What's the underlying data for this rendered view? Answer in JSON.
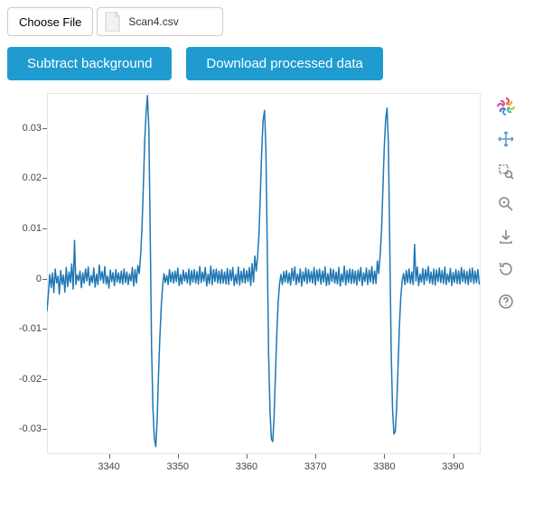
{
  "filepicker": {
    "button_label": "Choose File",
    "filename": "Scan4.csv"
  },
  "buttons": {
    "subtract": "Subtract background",
    "download": "Download processed data"
  },
  "toolbar": {
    "logo": "bokeh-logo",
    "tools": [
      {
        "name": "pan-icon",
        "active": true
      },
      {
        "name": "box-zoom-icon",
        "active": false
      },
      {
        "name": "wheel-zoom-icon",
        "active": false
      },
      {
        "name": "save-icon",
        "active": false
      },
      {
        "name": "reset-icon",
        "active": false
      },
      {
        "name": "help-icon",
        "active": false
      }
    ]
  },
  "chart_data": {
    "type": "line",
    "title": "",
    "xlabel": "",
    "ylabel": "",
    "xlim": [
      3331,
      3394
    ],
    "ylim": [
      -0.035,
      0.037
    ],
    "x_ticks": [
      3340,
      3350,
      3360,
      3370,
      3380,
      3390
    ],
    "y_ticks": [
      -0.03,
      -0.02,
      -0.01,
      0,
      0.01,
      0.02,
      0.03
    ],
    "series_color": "#1f77b4",
    "x": [
      3331.0,
      3331.2,
      3331.4,
      3331.6,
      3331.8,
      3332.0,
      3332.2,
      3332.4,
      3332.6,
      3332.8,
      3333.0,
      3333.2,
      3333.4,
      3333.6,
      3333.8,
      3334.0,
      3334.2,
      3334.4,
      3334.6,
      3334.8,
      3335.0,
      3335.2,
      3335.4,
      3335.6,
      3335.8,
      3336.0,
      3336.2,
      3336.4,
      3336.6,
      3336.8,
      3337.0,
      3337.2,
      3337.4,
      3337.6,
      3337.8,
      3338.0,
      3338.2,
      3338.4,
      3338.6,
      3338.8,
      3339.0,
      3339.2,
      3339.4,
      3339.6,
      3339.8,
      3340.0,
      3340.2,
      3340.4,
      3340.6,
      3340.8,
      3341.0,
      3341.2,
      3341.4,
      3341.6,
      3341.8,
      3342.0,
      3342.2,
      3342.4,
      3342.6,
      3342.8,
      3343.0,
      3343.2,
      3343.4,
      3343.6,
      3343.8,
      3344.0,
      3344.2,
      3344.4,
      3344.6,
      3344.8,
      3345.0,
      3345.2,
      3345.4,
      3345.6,
      3345.8,
      3346.0,
      3346.2,
      3346.4,
      3346.6,
      3346.8,
      3347.0,
      3347.2,
      3347.4,
      3347.6,
      3347.8,
      3348.0,
      3348.2,
      3348.4,
      3348.6,
      3348.8,
      3349.0,
      3349.2,
      3349.4,
      3349.6,
      3349.8,
      3350.0,
      3350.2,
      3350.4,
      3350.6,
      3350.8,
      3351.0,
      3351.2,
      3351.4,
      3351.6,
      3351.8,
      3352.0,
      3352.2,
      3352.4,
      3352.6,
      3352.8,
      3353.0,
      3353.2,
      3353.4,
      3353.6,
      3353.8,
      3354.0,
      3354.2,
      3354.4,
      3354.6,
      3354.8,
      3355.0,
      3355.2,
      3355.4,
      3355.6,
      3355.8,
      3356.0,
      3356.2,
      3356.4,
      3356.6,
      3356.8,
      3357.0,
      3357.2,
      3357.4,
      3357.6,
      3357.8,
      3358.0,
      3358.2,
      3358.4,
      3358.6,
      3358.8,
      3359.0,
      3359.2,
      3359.4,
      3359.6,
      3359.8,
      3360.0,
      3360.2,
      3360.4,
      3360.6,
      3360.8,
      3361.0,
      3361.2,
      3361.4,
      3361.6,
      3361.8,
      3362.0,
      3362.2,
      3362.4,
      3362.6,
      3362.8,
      3363.0,
      3363.2,
      3363.4,
      3363.6,
      3363.8,
      3364.0,
      3364.2,
      3364.4,
      3364.6,
      3364.8,
      3365.0,
      3365.2,
      3365.4,
      3365.6,
      3365.8,
      3366.0,
      3366.2,
      3366.4,
      3366.6,
      3366.8,
      3367.0,
      3367.2,
      3367.4,
      3367.6,
      3367.8,
      3368.0,
      3368.2,
      3368.4,
      3368.6,
      3368.8,
      3369.0,
      3369.2,
      3369.4,
      3369.6,
      3369.8,
      3370.0,
      3370.2,
      3370.4,
      3370.6,
      3370.8,
      3371.0,
      3371.2,
      3371.4,
      3371.6,
      3371.8,
      3372.0,
      3372.2,
      3372.4,
      3372.6,
      3372.8,
      3373.0,
      3373.2,
      3373.4,
      3373.6,
      3373.8,
      3374.0,
      3374.2,
      3374.4,
      3374.6,
      3374.8,
      3375.0,
      3375.2,
      3375.4,
      3375.6,
      3375.8,
      3376.0,
      3376.2,
      3376.4,
      3376.6,
      3376.8,
      3377.0,
      3377.2,
      3377.4,
      3377.6,
      3377.8,
      3378.0,
      3378.2,
      3378.4,
      3378.6,
      3378.8,
      3379.0,
      3379.2,
      3379.4,
      3379.6,
      3379.8,
      3380.0,
      3380.2,
      3380.4,
      3380.6,
      3380.8,
      3381.0,
      3381.2,
      3381.4,
      3381.6,
      3381.8,
      3382.0,
      3382.2,
      3382.4,
      3382.6,
      3382.8,
      3383.0,
      3383.2,
      3383.4,
      3383.6,
      3383.8,
      3384.0,
      3384.2,
      3384.4,
      3384.6,
      3384.8,
      3385.0,
      3385.2,
      3385.4,
      3385.6,
      3385.8,
      3386.0,
      3386.2,
      3386.4,
      3386.6,
      3386.8,
      3387.0,
      3387.2,
      3387.4,
      3387.6,
      3387.8,
      3388.0,
      3388.2,
      3388.4,
      3388.6,
      3388.8,
      3389.0,
      3389.2,
      3389.4,
      3389.6,
      3389.8,
      3390.0,
      3390.2,
      3390.4,
      3390.6,
      3390.8,
      3391.0,
      3391.2,
      3391.4,
      3391.6,
      3391.8,
      3392.0,
      3392.2,
      3392.4,
      3392.6,
      3392.8,
      3393.0,
      3393.2,
      3393.4,
      3393.6,
      3393.8,
      3394.0
    ],
    "y": [
      -0.0065,
      -0.0032,
      0.0008,
      -0.0018,
      0.0011,
      -0.0028,
      0.0019,
      -0.0009,
      0.0005,
      -0.0031,
      0.0016,
      -0.0012,
      0.0007,
      -0.0027,
      0.0022,
      -0.0016,
      0.0013,
      -0.0008,
      0.0029,
      -0.0021,
      0.0076,
      -0.0012,
      0.0007,
      -0.0004,
      0.0015,
      -0.0018,
      0.0011,
      -0.0009,
      0.0019,
      -0.0005,
      0.0023,
      -0.0014,
      0.0006,
      -0.0008,
      0.0021,
      -0.0017,
      0.0009,
      -0.0012,
      0.0027,
      -0.0003,
      0.0014,
      -0.0009,
      0.0024,
      -0.0011,
      0.0005,
      -0.0019,
      0.0017,
      -0.0006,
      0.0012,
      -0.0014,
      0.0018,
      -0.0007,
      0.0011,
      -0.0009,
      0.0015,
      -0.0011,
      0.0019,
      -0.0008,
      0.0013,
      -0.0012,
      0.0009,
      -0.0005,
      0.0022,
      -0.0015,
      0.0018,
      -0.0009,
      0.0026,
      0.001,
      0.0045,
      0.0098,
      0.0185,
      0.0275,
      0.033,
      0.0365,
      0.0295,
      0.0085,
      -0.014,
      -0.026,
      -0.032,
      -0.0335,
      -0.0285,
      -0.0195,
      -0.0115,
      -0.0055,
      -0.0015,
      0.001,
      -0.0008,
      0.0006,
      -0.0012,
      0.0018,
      -0.0007,
      0.0013,
      -0.0009,
      0.0015,
      -0.0006,
      0.0021,
      -0.0014,
      0.0008,
      -0.0011,
      0.0017,
      -0.0005,
      0.0012,
      -0.0009,
      0.0019,
      -0.0013,
      0.0016,
      -0.0007,
      0.0018,
      -0.0009,
      0.0014,
      -0.0011,
      0.0024,
      -0.0008,
      0.0013,
      -0.0005,
      0.0022,
      -0.0015,
      0.0009,
      -0.001,
      0.0025,
      -0.0012,
      0.0018,
      -0.0006,
      0.0019,
      -0.0009,
      0.0015,
      -0.001,
      0.0018,
      -0.0009,
      0.0013,
      -0.0011,
      0.002,
      -0.0012,
      0.0017,
      -0.0004,
      0.0022,
      -0.0014,
      0.0008,
      -0.001,
      0.0023,
      -0.0013,
      0.0015,
      -0.0008,
      0.002,
      -0.0009,
      0.0016,
      -0.0006,
      0.0022,
      -0.0014,
      0.003,
      -0.0007,
      0.0045,
      0.0015,
      0.0042,
      0.009,
      0.017,
      0.0255,
      0.0315,
      0.0335,
      0.026,
      0.0065,
      -0.015,
      -0.0265,
      -0.032,
      -0.0325,
      -0.0275,
      -0.0185,
      -0.0105,
      -0.0045,
      -0.001,
      0.0008,
      -0.0012,
      0.0014,
      -0.0007,
      0.0016,
      -0.0009,
      0.0011,
      -0.0013,
      0.002,
      -0.0004,
      0.0023,
      -0.0012,
      0.0009,
      -0.0008,
      0.0019,
      -0.0015,
      0.0013,
      -0.0006,
      0.0021,
      -0.001,
      0.0018,
      -0.0007,
      0.0014,
      -0.0009,
      0.0022,
      -0.0013,
      0.0017,
      -0.0005,
      0.0019,
      -0.0011,
      0.0015,
      -0.0007,
      0.0023,
      -0.0014,
      0.001,
      -0.0012,
      0.002,
      -0.0006,
      0.0018,
      -0.0009,
      0.0013,
      -0.0011,
      0.0022,
      -0.0015,
      0.0009,
      -0.0007,
      0.0025,
      -0.0013,
      0.0016,
      -0.0008,
      0.0019,
      -0.001,
      0.0018,
      -0.0009,
      0.0015,
      -0.0013,
      0.0017,
      -0.0005,
      0.0022,
      -0.0014,
      0.0011,
      -0.0006,
      0.0021,
      -0.0012,
      0.0017,
      -0.0007,
      0.0024,
      -0.001,
      0.0015,
      -0.001,
      0.0035,
      0.001,
      0.0048,
      0.0095,
      0.0178,
      0.026,
      0.0318,
      0.034,
      0.027,
      0.007,
      -0.0145,
      -0.026,
      -0.031,
      -0.0305,
      -0.026,
      -0.0175,
      -0.0095,
      -0.0038,
      -0.0005,
      0.001,
      -0.0012,
      0.0016,
      -0.0008,
      0.0019,
      -0.001,
      0.0013,
      -0.0012,
      0.0068,
      -0.0005,
      0.0023,
      -0.0014,
      0.0009,
      -0.0007,
      0.002,
      -0.0012,
      0.0018,
      -0.0004,
      0.0024,
      -0.0009,
      0.0013,
      -0.0011,
      0.0019,
      -0.0013,
      0.0017,
      -0.0006,
      0.0021,
      -0.0008,
      0.0016,
      -0.001,
      0.0023,
      -0.0012,
      0.0009,
      -0.0007,
      0.002,
      -0.0014,
      0.0012,
      -0.0008,
      0.0018,
      -0.001,
      0.0015,
      -0.0011,
      0.0022,
      -0.0006,
      0.0017,
      -0.0009,
      0.0014,
      -0.0012,
      0.0019,
      -0.0007,
      0.0021,
      -0.001,
      0.0015,
      -0.0008,
      0.0018,
      -0.0012
    ]
  }
}
